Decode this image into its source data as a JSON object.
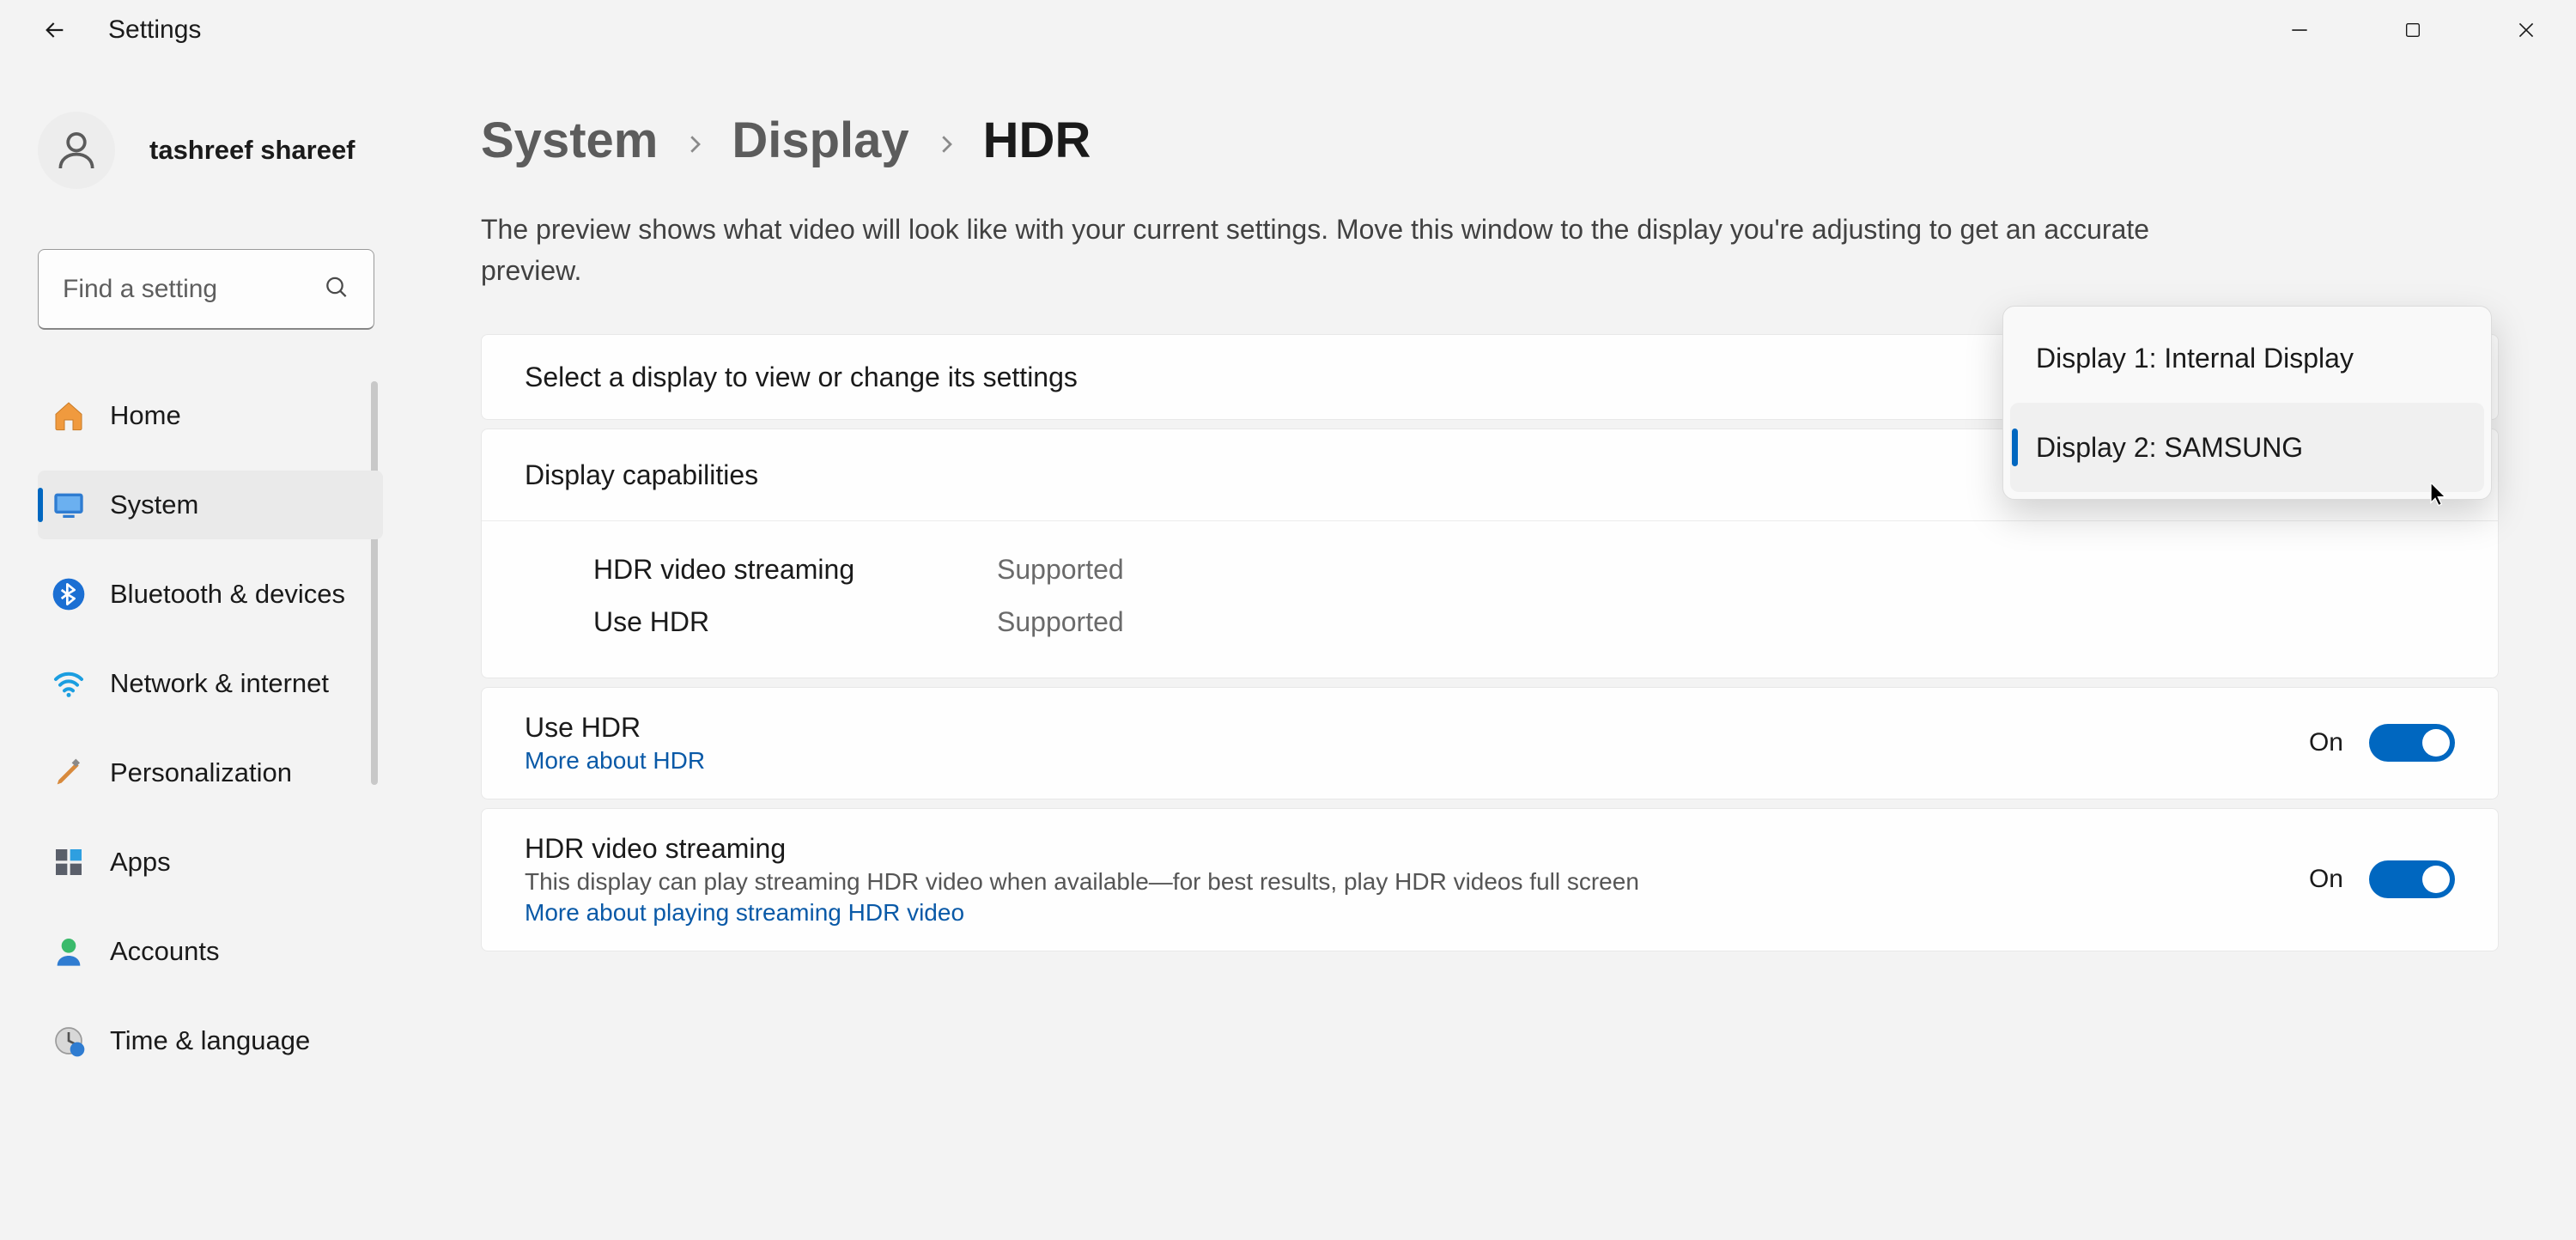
{
  "app_title": "Settings",
  "user_name": "tashreef shareef",
  "search_placeholder": "Find a setting",
  "nav": [
    {
      "label": "Home"
    },
    {
      "label": "System"
    },
    {
      "label": "Bluetooth & devices"
    },
    {
      "label": "Network & internet"
    },
    {
      "label": "Personalization"
    },
    {
      "label": "Apps"
    },
    {
      "label": "Accounts"
    },
    {
      "label": "Time & language"
    }
  ],
  "breadcrumb": {
    "level1": "System",
    "level2": "Display",
    "current": "HDR"
  },
  "page_description": "The preview shows what video will look like with your current settings. Move this window to the display you're adjusting to get an accurate preview.",
  "display_selector": {
    "label": "Select a display to view or change its settings",
    "options": [
      "Display 1: Internal Display",
      "Display 2: SAMSUNG"
    ]
  },
  "capabilities": {
    "header": "Display capabilities",
    "rows": [
      {
        "key": "HDR video streaming",
        "val": "Supported"
      },
      {
        "key": "Use HDR",
        "val": "Supported"
      }
    ]
  },
  "settings": {
    "use_hdr": {
      "title": "Use HDR",
      "link": "More about HDR",
      "state": "On"
    },
    "hdr_streaming": {
      "title": "HDR video streaming",
      "sub": "This display can play streaming HDR video when available—for best results, play HDR videos full screen",
      "link": "More about playing streaming HDR video",
      "state": "On"
    }
  }
}
